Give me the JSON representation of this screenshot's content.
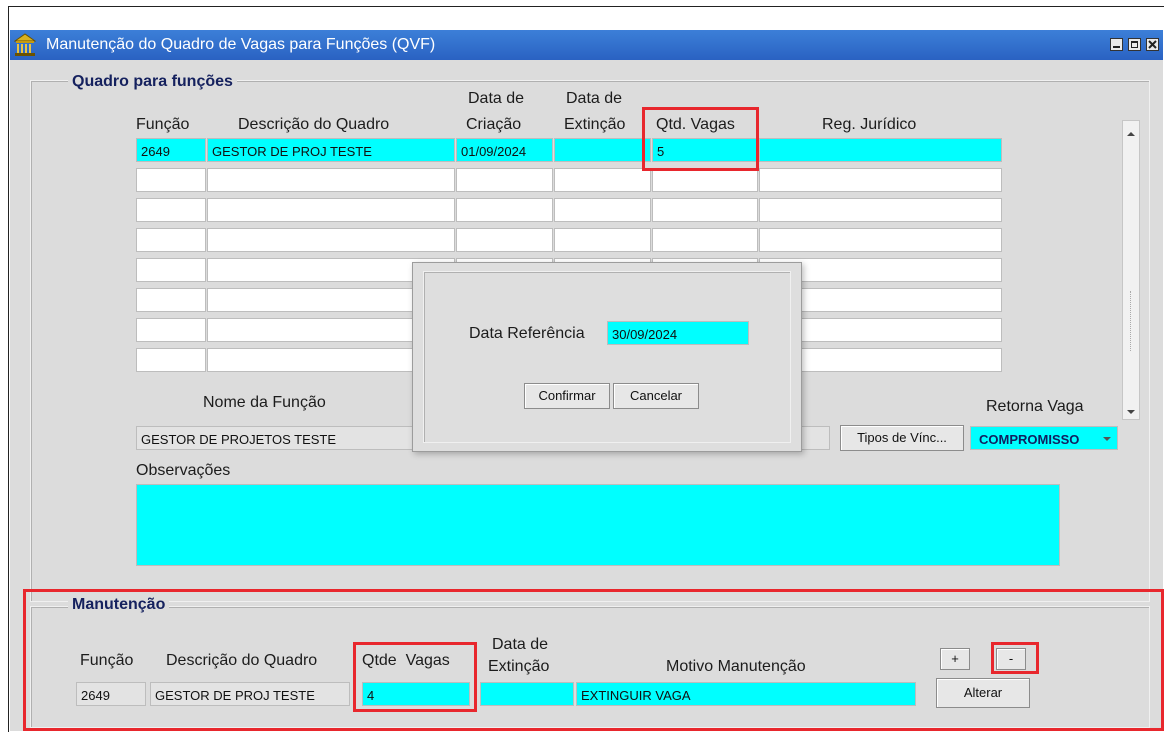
{
  "window": {
    "title": "Manutenção do Quadro de Vagas para Funções (QVF)",
    "colors": {
      "titlebar": "#2a62c2",
      "field_active": "#00ffff",
      "highlight": "#e8272d"
    }
  },
  "quadro": {
    "section_title": "Quadro para funções",
    "headers": {
      "funcao": "Função",
      "descricao": "Descrição do Quadro",
      "data_criacao_1": "Data de",
      "data_criacao_2": "Criação",
      "data_extincao_1": "Data de",
      "data_extincao_2": "Extinção",
      "qtd_vagas": "Qtd. Vagas",
      "reg_juridico": "Reg. Jurídico"
    },
    "row1": {
      "funcao": "2649",
      "descricao": "GESTOR DE PROJ TESTE",
      "data_criacao": "01/09/2024",
      "data_extincao": "",
      "qtd_vagas": "5",
      "reg_juridico": ""
    },
    "nome_funcao_label": "Nome da Função",
    "nome_funcao_value": "GESTOR DE PROJETOS TESTE",
    "tipos_vinc_button": "Tipos de Vínc...",
    "retorna_vaga_label": "Retorna Vaga",
    "retorna_vaga_value": "COMPROMISSO",
    "observacoes_label": "Observações"
  },
  "dialog": {
    "data_referencia_label": "Data Referência",
    "data_referencia_value": "30/09/2024",
    "confirm_button": "Confirmar",
    "cancel_button": "Cancelar"
  },
  "manutencao": {
    "section_title": "Manutenção",
    "headers": {
      "funcao": "Função",
      "descricao": "Descrição do Quadro",
      "qtde_vagas": "Qtde  Vagas",
      "data_extincao_1": "Data de",
      "data_extincao_2": "Extinção",
      "motivo": "Motivo Manutenção"
    },
    "row": {
      "funcao": "2649",
      "descricao": "GESTOR DE PROJ TESTE",
      "qtde_vagas": "4",
      "data_extincao": "",
      "motivo": "EXTINGUIR VAGA"
    },
    "plus_button": "+",
    "minus_button": "-",
    "alterar_button": "Alterar"
  }
}
